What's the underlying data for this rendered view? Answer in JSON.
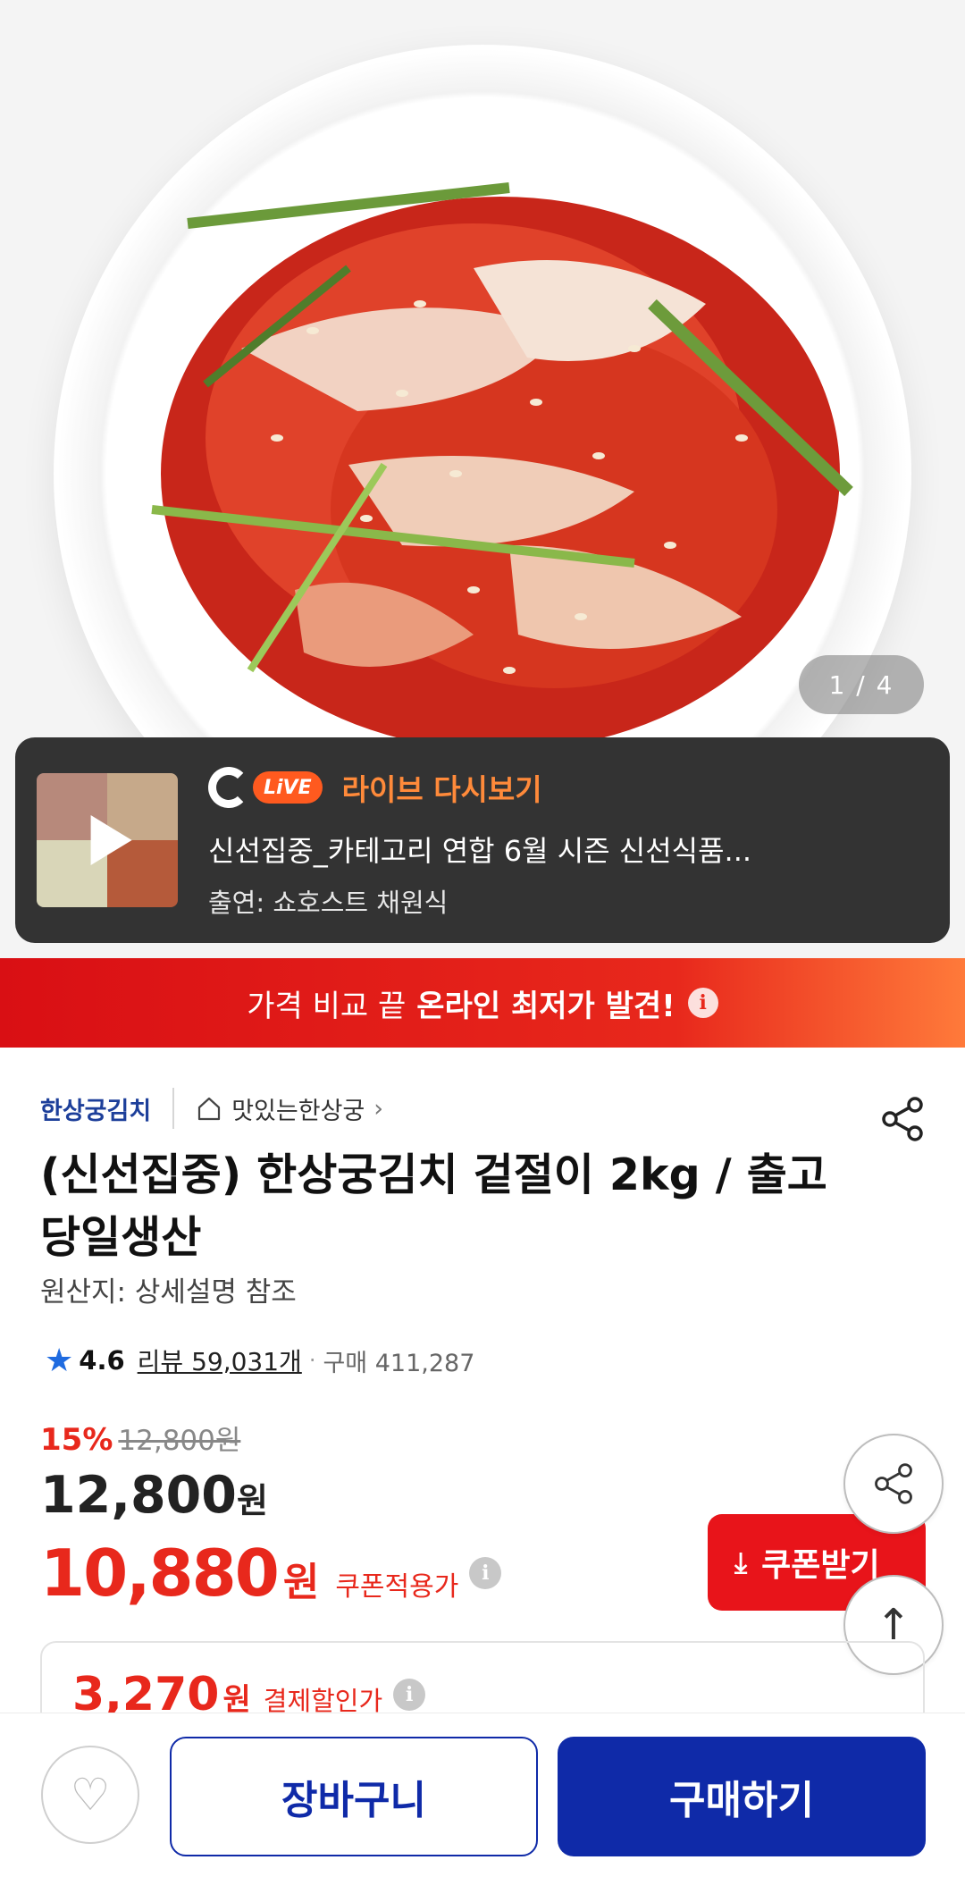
{
  "gallery": {
    "counter": "1 / 4"
  },
  "live": {
    "badge": "LiVE",
    "replay_label": "라이브 다시보기",
    "title": "신선집중_카테고리 연합 6월 시즌 신선식품...",
    "host": "출연: 쇼호스트 채원식"
  },
  "promo_banner": {
    "text": "가격 비교 끝",
    "highlight": "온라인 최저가 발견!",
    "info_icon": "i"
  },
  "product": {
    "brand": "한상궁김치",
    "shop_link": "맛있는한상궁",
    "shop_chevron": "›",
    "title": "(신선집중) 한상궁김치 겉절이 2kg / 출고당일생산",
    "origin": "원산지: 상세설명 참조",
    "rating": "4.6",
    "review_count": "리뷰 59,031개",
    "purchase_count": "구매 411,287"
  },
  "pricing": {
    "discount": "15%",
    "original_price": "12,800원",
    "price": "12,800",
    "price_unit": "원",
    "coupon_price": "10,880",
    "coupon_unit": "원",
    "coupon_label": "쿠폰적용가",
    "coupon_button": "쿠폰받기",
    "pay_price": "3,270",
    "pay_unit": "원",
    "pay_label": "결제할인가"
  },
  "bottom_bar": {
    "cart": "장바구니",
    "buy": "구매하기"
  },
  "colors": {
    "accent_red": "#e8281c",
    "brand_blue": "#0f2aa8",
    "live_orange": "#ff5a1f",
    "star_blue": "#1f6be0"
  },
  "icons": [
    "play-icon",
    "g-live-logo",
    "info-icon",
    "home-icon",
    "chevron-right-icon",
    "share-icon",
    "star-icon",
    "download-icon",
    "arrow-up-icon",
    "heart-icon"
  ]
}
